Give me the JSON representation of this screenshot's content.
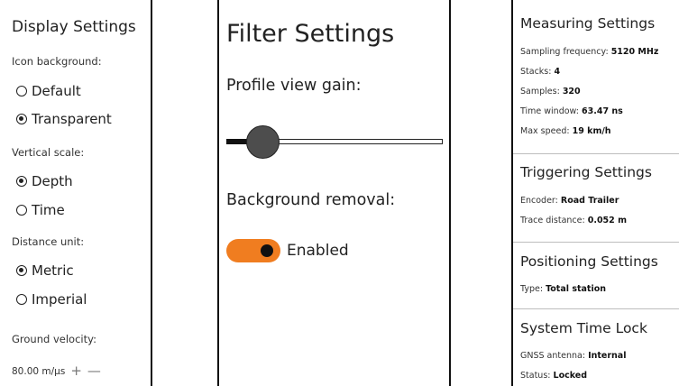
{
  "display": {
    "title": "Display Settings",
    "icon_bg_label": "Icon background:",
    "icon_bg_options": [
      "Default",
      "Transparent"
    ],
    "vertical_scale_label": "Vertical scale:",
    "vertical_scale_options": [
      "Depth",
      "Time"
    ],
    "distance_unit_label": "Distance unit:",
    "distance_unit_options": [
      "Metric",
      "Imperial"
    ],
    "ground_velocity_label": "Ground velocity:",
    "ground_velocity_value": "80.00 m/µs",
    "plus": "+",
    "minus": "—",
    "selected": {
      "icon_background": "Transparent",
      "vertical_scale": "Depth",
      "distance_unit": "Metric"
    }
  },
  "filter": {
    "title": "Filter Settings",
    "gain_label": "Profile view gain:",
    "gain_level_fraction": 0.1,
    "bg_removal_label": "Background removal:",
    "bg_removal_state": "Enabled",
    "toggle_color": "#f07d20"
  },
  "measuring": {
    "title": "Measuring Settings",
    "rows": [
      {
        "label": "Sampling frequency:",
        "value": "5120 MHz"
      },
      {
        "label": "Stacks:",
        "value": "4"
      },
      {
        "label": "Samples:",
        "value": "320"
      },
      {
        "label": "Time window:",
        "value": "63.47 ns"
      },
      {
        "label": "Max speed:",
        "value": "19 km/h"
      }
    ]
  },
  "triggering": {
    "title": "Triggering Settings",
    "rows": [
      {
        "label": "Encoder:",
        "value": "Road Trailer"
      },
      {
        "label": "Trace distance:",
        "value": "0.052 m"
      }
    ]
  },
  "positioning": {
    "title": "Positioning Settings",
    "rows": [
      {
        "label": "Type:",
        "value": "Total station"
      }
    ]
  },
  "time_lock": {
    "title": "System Time Lock",
    "rows": [
      {
        "label": "GNSS antenna:",
        "value": "Internal"
      },
      {
        "label": "Status:",
        "value": "Locked"
      }
    ]
  }
}
